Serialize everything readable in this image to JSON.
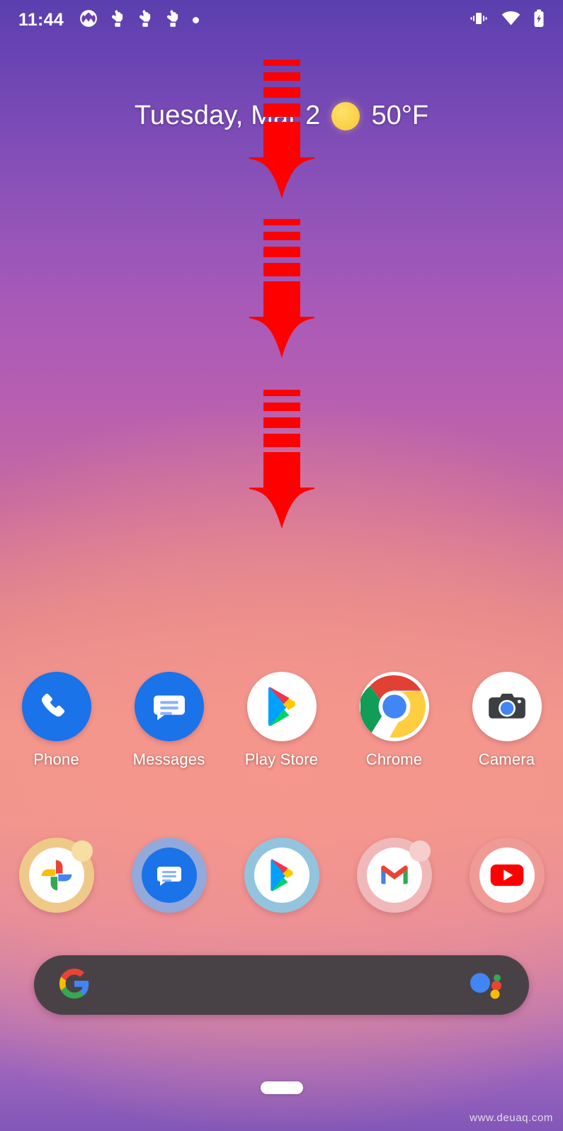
{
  "status_bar": {
    "time": "11:44",
    "left_icons": [
      {
        "name": "xbox-icon",
        "label": "Xbox"
      },
      {
        "name": "touch-gesture-icon-1",
        "label": "Touch gesture"
      },
      {
        "name": "touch-gesture-icon-2",
        "label": "Touch gesture"
      },
      {
        "name": "touch-gesture-icon-3",
        "label": "Touch gesture"
      },
      {
        "name": "notification-dot-icon",
        "label": "More notifications"
      }
    ],
    "right_icons": [
      {
        "name": "vibrate-icon",
        "label": "Vibrate"
      },
      {
        "name": "wifi-icon",
        "label": "Wi-Fi"
      },
      {
        "name": "battery-charging-icon",
        "label": "Battery charging"
      }
    ]
  },
  "widget": {
    "date": "Tuesday, Mar 2",
    "weather_icon": "sun-icon",
    "temperature": "50°F"
  },
  "annotations": {
    "color": "#FF0000",
    "arrows": [
      {
        "name": "swipe-down-arrow-1",
        "direction": "down"
      },
      {
        "name": "swipe-down-arrow-2",
        "direction": "down"
      },
      {
        "name": "swipe-down-arrow-3",
        "direction": "down"
      }
    ]
  },
  "app_grid": [
    {
      "name": "phone",
      "label": "Phone",
      "icon": "phone-icon",
      "bg": "#1A73E8"
    },
    {
      "name": "messages",
      "label": "Messages",
      "icon": "messages-icon",
      "bg": "#1A73E8"
    },
    {
      "name": "play-store",
      "label": "Play Store",
      "icon": "play-store-icon",
      "bg": "#FFFFFF"
    },
    {
      "name": "chrome",
      "label": "Chrome",
      "icon": "chrome-icon",
      "bg": "#FFFFFF"
    },
    {
      "name": "camera",
      "label": "Camera",
      "icon": "camera-icon",
      "bg": "#FFFFFF"
    }
  ],
  "dock": [
    {
      "name": "photos",
      "label": "Photos",
      "icon": "google-photos-icon",
      "ring": "#EFC98A",
      "has_badge": true,
      "badge_color": "#F7DFA3"
    },
    {
      "name": "messages",
      "label": "Messages",
      "icon": "messages-icon",
      "ring": "#93A9DB",
      "has_badge": false,
      "badge_color": ""
    },
    {
      "name": "play-store",
      "label": "Play Store",
      "icon": "play-store-icon",
      "ring": "#93C4DE",
      "has_badge": false,
      "badge_color": ""
    },
    {
      "name": "gmail",
      "label": "Gmail",
      "icon": "gmail-icon",
      "ring": "#F0B8B8",
      "has_badge": true,
      "badge_color": "#F6CFCC"
    },
    {
      "name": "youtube",
      "label": "YouTube",
      "icon": "youtube-icon",
      "ring": "#F09A96",
      "has_badge": false,
      "badge_color": ""
    }
  ],
  "search": {
    "placeholder": "",
    "value": "",
    "left_icon": "google-g-icon",
    "right_icon": "google-assistant-icon",
    "background": "#484246"
  },
  "navigation": {
    "pill": "home-gesture-pill"
  },
  "watermark": "www.deuaq.com"
}
